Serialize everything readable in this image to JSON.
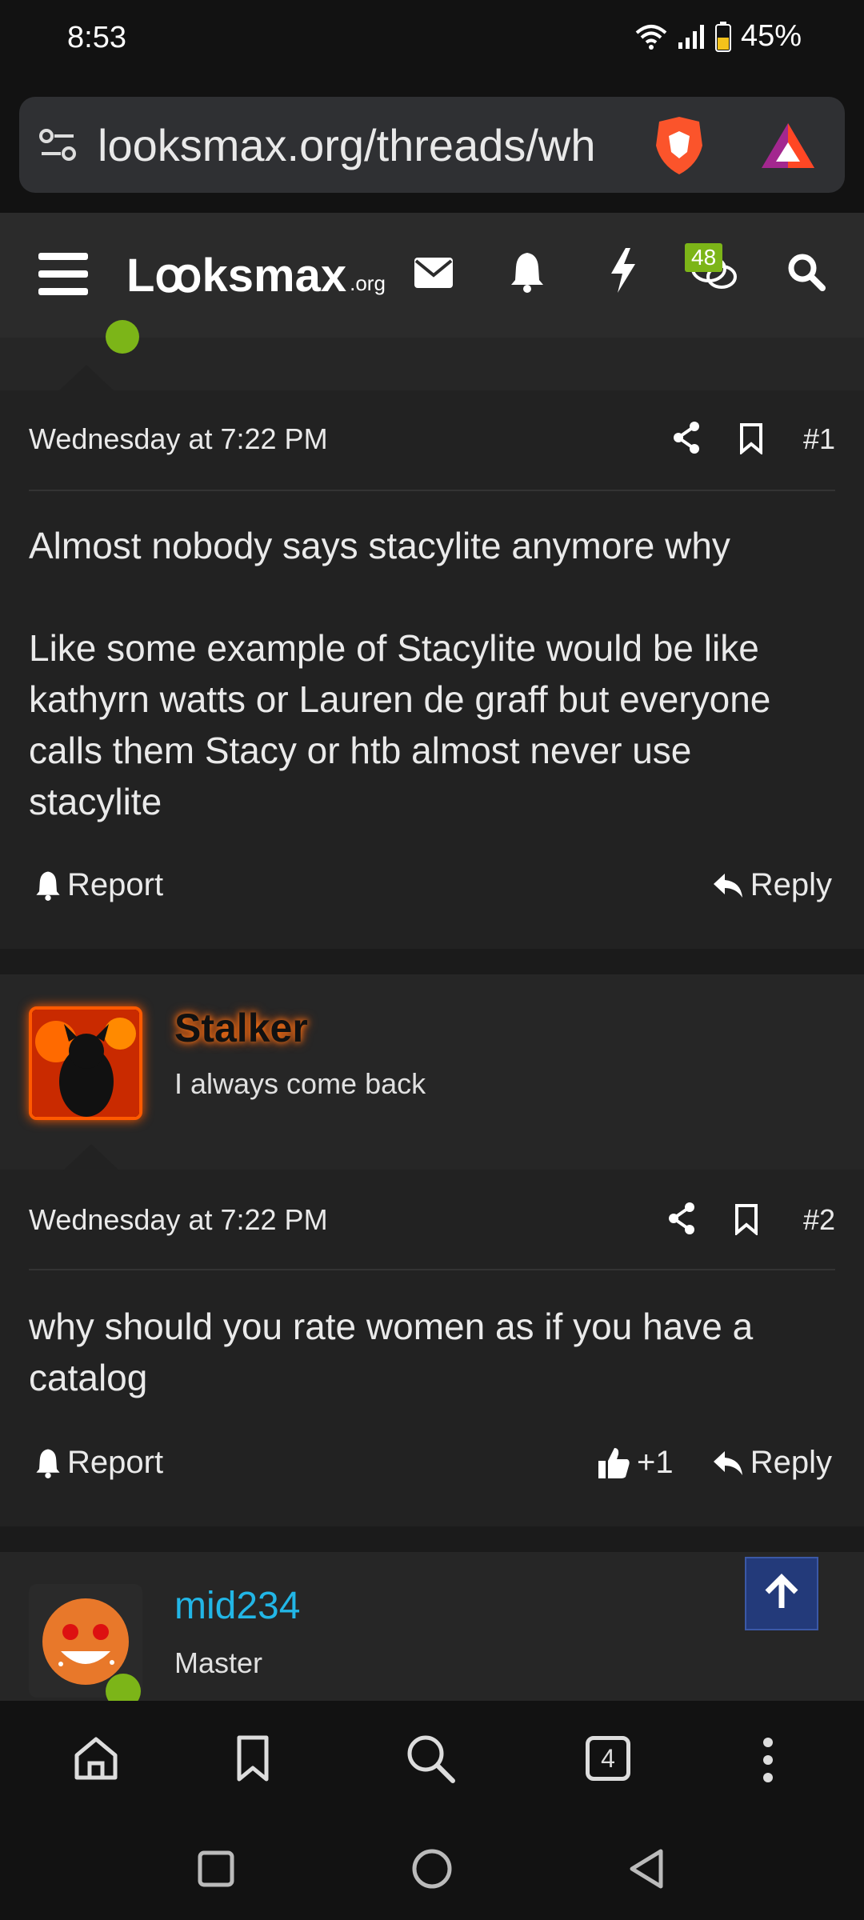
{
  "status": {
    "time": "8:53",
    "battery": "45%"
  },
  "browser": {
    "url": "looksmax.org/threads/wh",
    "tab_count": "4"
  },
  "site": {
    "logo": "Lꝏksmax",
    "logo_suffix": ".org",
    "chat_badge": "48"
  },
  "posts": [
    {
      "date": "Wednesday at 7:22 PM",
      "number": "#1",
      "body": "Almost nobody says stacylite anymore why\n\nLike some example of Stacylite would be like kathyrn watts or Lauren de graff but everyone calls them Stacy or htb almost never use stacylite",
      "report": "Report",
      "reply": "Reply"
    },
    {
      "username": "Stalker",
      "user_title": "I always come back",
      "date": "Wednesday at 7:22 PM",
      "number": "#2",
      "body": "why should you rate women as if you have a catalog",
      "report": "Report",
      "likes": "+1",
      "reply": "Reply"
    },
    {
      "username": "mid234",
      "user_title": "Master"
    }
  ],
  "colors": {
    "accent_green": "#7cb518",
    "username_blue": "#22b6e6",
    "stalker_glow": "#ff5a00"
  }
}
